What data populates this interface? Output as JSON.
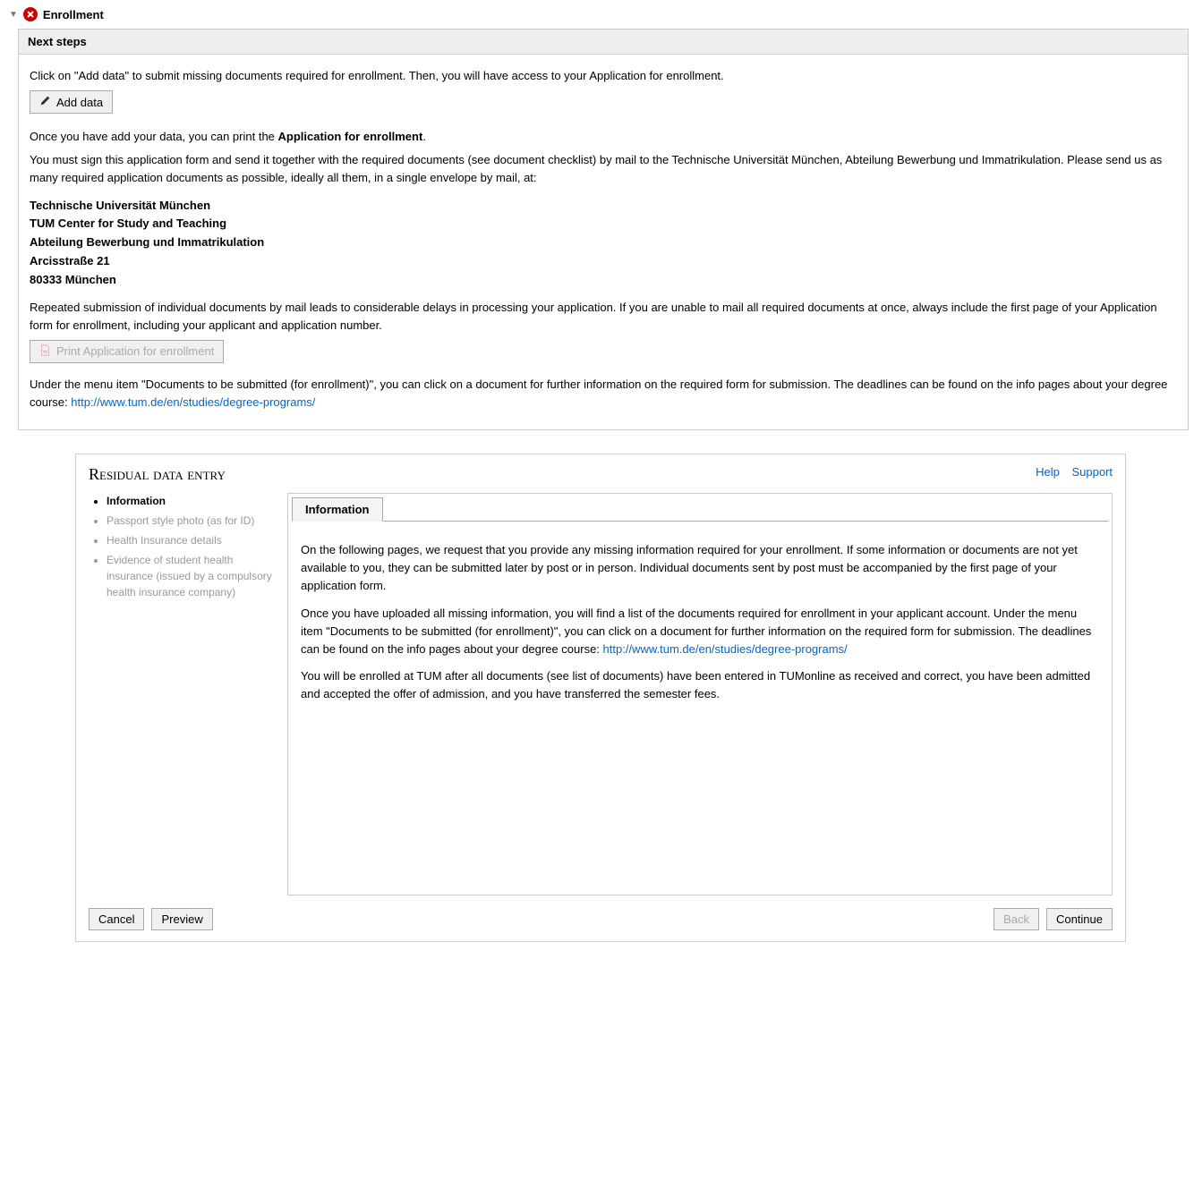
{
  "enrollment": {
    "title": "Enrollment",
    "nextStepsHeader": "Next steps",
    "intro": "Click on \"Add data\" to submit missing documents required for enrollment. Then, you will have access to your Application for enrollment.",
    "addDataBtn": "Add data",
    "para2_prefix": "Once you have add your data, you can print the ",
    "para2_bold": "Application for enrollment",
    "para2_suffix": ".",
    "para3": "You must sign this application form and send it together with the required documents (see document checklist) by mail to the Technische Universität München, Abteilung Bewerbung und Immatrikulation. Please send us as many required application documents as possible, ideally all them, in a single envelope by mail, at:",
    "address": {
      "l1": "Technische Universität München",
      "l2": "TUM Center for Study and Teaching",
      "l3": "Abteilung Bewerbung und Immatrikulation",
      "l4": "Arcisstraße 21",
      "l5": "80333 München"
    },
    "para4": "Repeated submission of individual documents by mail leads to considerable delays in processing your application. If you are unable to mail all required documents at once, always include the first page of your Application form for enrollment, including your applicant and application number.",
    "printBtn": "Print Application for enrollment",
    "para5_prefix": "Under the menu item \"Documents to be submitted (for enrollment)\", you can click on a document for further information on the required form for submission. The deadlines can be found on the info pages about your degree course: ",
    "link": "http://www.tum.de/en/studies/degree-programs/"
  },
  "residual": {
    "title": "Residual data entry",
    "helpLink": "Help",
    "supportLink": "Support",
    "sidebar": {
      "items": [
        "Information",
        "Passport style photo (as for ID)",
        "Health Insurance details",
        "Evidence of student health insurance (issued by a compulsory health insurance company)"
      ]
    },
    "tabLabel": "Information",
    "content": {
      "p1": "On the following pages, we request that you provide any missing information required for your enrollment. If some information or documents are not yet available to you, they can be submitted later by post or in person. Individual documents sent by post must be accompanied by the first page of your application form.",
      "p2_prefix": "Once you have uploaded all missing information, you will find a list of the documents required for enrollment in your applicant account. Under the menu item \"Documents to be submitted (for enrollment)\", you can click on a document for further information on the required form for submission. The deadlines can be found on the info pages about your degree course: ",
      "p2_link": "http://www.tum.de/en/studies/degree-programs/",
      "p3": "You will be enrolled at TUM after all documents (see list of documents) have been entered in TUMonline as received and correct, you have been admitted and accepted the offer of admission, and you have transferred the semester fees."
    },
    "buttons": {
      "cancel": "Cancel",
      "preview": "Preview",
      "back": "Back",
      "continue": "Continue"
    }
  }
}
